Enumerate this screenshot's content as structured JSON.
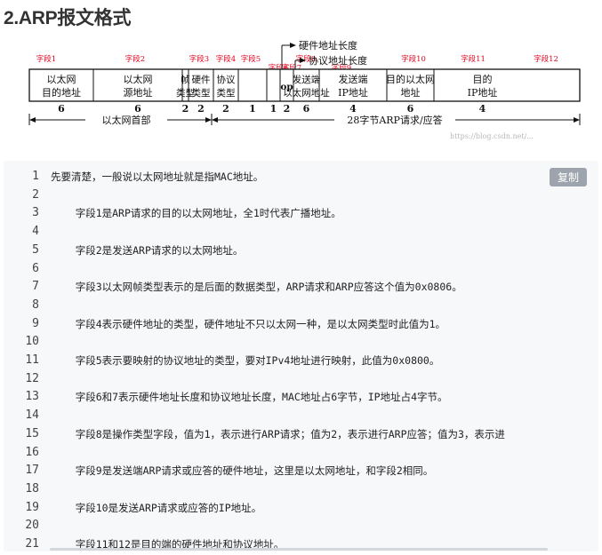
{
  "section_title": "2.ARP报文格式",
  "diagram": {
    "fields": [
      {
        "tag": "字段1",
        "line1": "以太网",
        "line2": "目的地址",
        "size": "6"
      },
      {
        "tag": "字段2",
        "line1": "以太网",
        "line2": "源地址",
        "size": "6"
      },
      {
        "tag": "字段3",
        "line1": "帧",
        "line2": "类型",
        "size": "2"
      },
      {
        "tag": "字段4",
        "line1": "硬件",
        "line2": "类型",
        "size": "2"
      },
      {
        "tag": "字段5",
        "line1": "协议",
        "line2": "类型",
        "size": "2"
      },
      {
        "tag": "字段6",
        "line1": "",
        "line2": "",
        "size": "1"
      },
      {
        "tag": "字段7",
        "line1": "",
        "line2": "",
        "size": "1"
      },
      {
        "tag": "字段8",
        "line1": "op",
        "line2": "",
        "size": "2"
      },
      {
        "tag": "字段9",
        "line1": "发送端",
        "line2": "以太网地址",
        "size": "6"
      },
      {
        "tag": "字段10",
        "line1": "发送端",
        "line2": "IP地址",
        "size": "4"
      },
      {
        "tag": "字段11",
        "line1": "目的以太网",
        "line2": "地址",
        "size": "6"
      },
      {
        "tag": "字段12",
        "line1": "目的",
        "line2": "IP地址",
        "size": "4"
      }
    ],
    "hw_len_label": "硬件地址长度",
    "proto_len_label": "协议地址长度",
    "eth_header_label": "以太网首部",
    "arp_body_label": "28字节ARP请求/应答",
    "watermark": "https://blog.csdn.net/..."
  },
  "code_block": {
    "copy_label": "复制",
    "lines": [
      {
        "n": "1",
        "text": "先要清楚，一般说以太网地址就是指MAC地址。"
      },
      {
        "n": "2",
        "text": ""
      },
      {
        "n": "3",
        "text": "    字段1是ARP请求的目的以太网地址，全1时代表广播地址。"
      },
      {
        "n": "4",
        "text": ""
      },
      {
        "n": "5",
        "text": "    字段2是发送ARP请求的以太网地址。"
      },
      {
        "n": "6",
        "text": ""
      },
      {
        "n": "7",
        "text": "    字段3以太网帧类型表示的是后面的数据类型，ARP请求和ARP应答这个值为0x0806。"
      },
      {
        "n": "8",
        "text": ""
      },
      {
        "n": "9",
        "text": "    字段4表示硬件地址的类型，硬件地址不只以太网一种，是以太网类型时此值为1。"
      },
      {
        "n": "10",
        "text": ""
      },
      {
        "n": "11",
        "text": "    字段5表示要映射的协议地址的类型，要对IPv4地址进行映射，此值为0x0800。"
      },
      {
        "n": "12",
        "text": ""
      },
      {
        "n": "13",
        "text": "    字段6和7表示硬件地址长度和协议地址长度，MAC地址占6字节，IP地址占4字节。"
      },
      {
        "n": "14",
        "text": ""
      },
      {
        "n": "15",
        "text": "    字段8是操作类型字段，值为1，表示进行ARP请求；值为2，表示进行ARP应答；值为3，表示进"
      },
      {
        "n": "16",
        "text": ""
      },
      {
        "n": "17",
        "text": "    字段9是发送端ARP请求或应答的硬件地址，这里是以太网地址，和字段2相同。"
      },
      {
        "n": "18",
        "text": ""
      },
      {
        "n": "19",
        "text": "    字段10是发送ARP请求或应答的IP地址。"
      },
      {
        "n": "20",
        "text": ""
      },
      {
        "n": "21",
        "text": "    字段11和12是目的端的硬件地址和协议地址。"
      }
    ]
  }
}
